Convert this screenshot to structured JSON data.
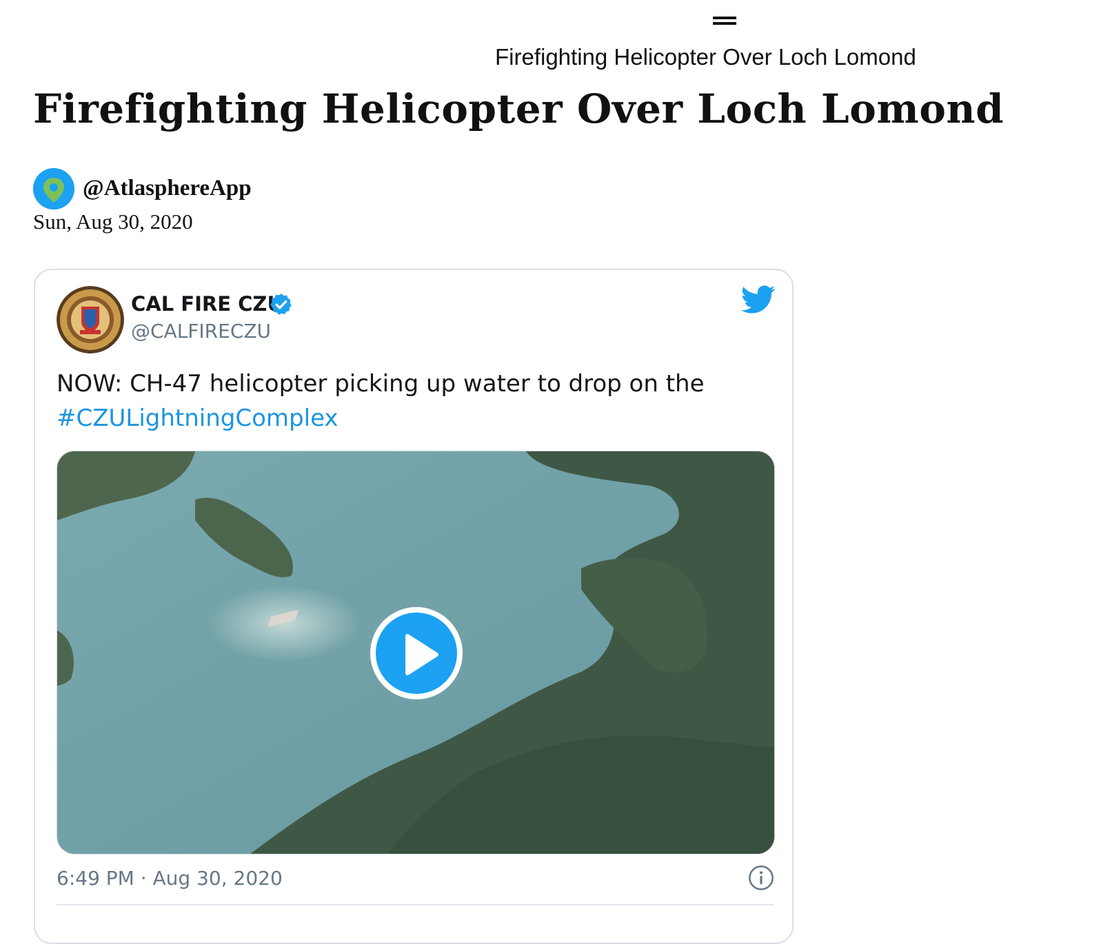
{
  "header": {
    "menu_icon": "hamburger-menu-icon",
    "title": "Firefighting Helicopter Over Loch Lomond"
  },
  "article": {
    "title": "Firefighting Helicopter Over Loch Lomond",
    "author_handle": "@AtlasphereApp",
    "date": "Sun, Aug 30, 2020"
  },
  "tweet": {
    "name": "CAL FIRE CZU",
    "handle": "@CALFIRECZU",
    "text": "NOW: CH-47 helicopter picking up water to drop on the",
    "hashtag": "#CZULightningComplex",
    "timestamp": "6:49 PM · Aug 30, 2020",
    "icons": [
      "verified-badge-icon",
      "twitter-bird-icon",
      "play-icon",
      "info-icon"
    ]
  },
  "colors": {
    "twitter_blue": "#1da1f2",
    "hashtag": "#1b95e0",
    "muted_text": "#657786",
    "card_border": "#d8dfe5"
  }
}
